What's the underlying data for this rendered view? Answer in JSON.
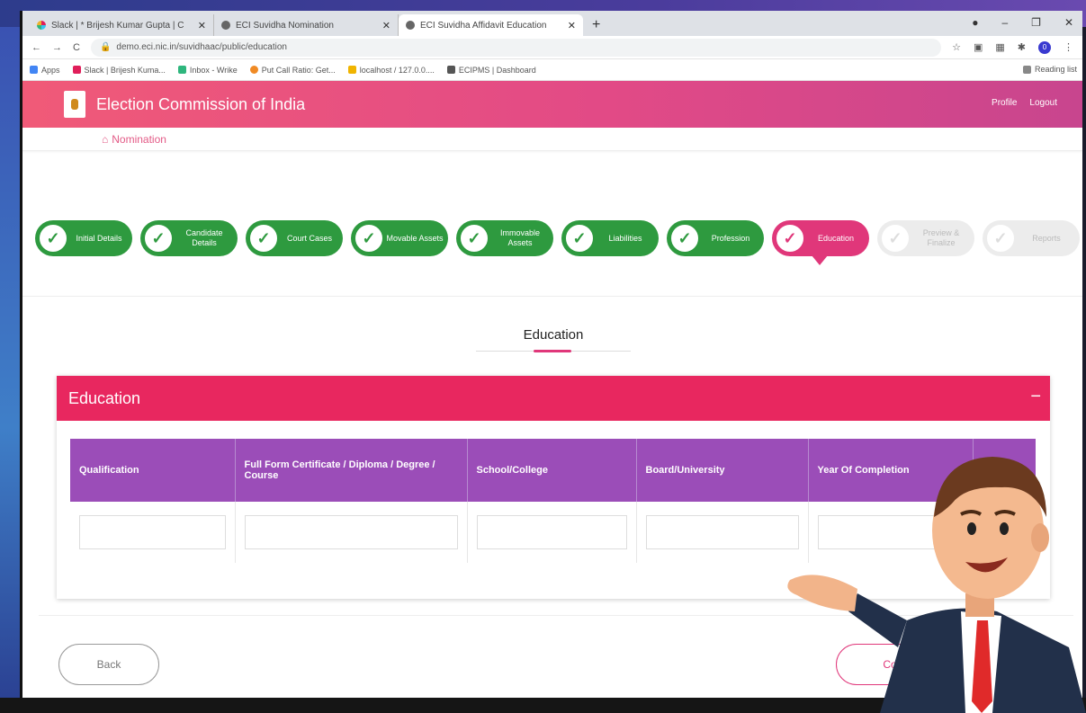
{
  "browser": {
    "tabs": [
      {
        "title": "Slack | * Brijesh Kumar Gupta | C",
        "icon": "slack-icon",
        "active": false
      },
      {
        "title": "ECI Suvidha Nomination",
        "icon": "globe-icon",
        "active": false
      },
      {
        "title": "ECI Suvidha Affidavit Education",
        "icon": "globe-icon",
        "active": true
      }
    ],
    "url": "demo.eci.nic.in/suvidhaac/public/education",
    "bookmarks": [
      "Apps",
      "Slack | Brijesh Kuma...",
      "Inbox - Wrike",
      "Put Call Ratio: Get...",
      "localhost / 127.0.0....",
      "ECIPMS | Dashboard"
    ],
    "reading_list": "Reading list",
    "avatar_letter": "0"
  },
  "header": {
    "title": "Election Commission of India",
    "nav": [
      "Profile",
      "Logout"
    ]
  },
  "breadcrumb": "Nomination",
  "steps": [
    {
      "label": "Initial Details",
      "state": "done"
    },
    {
      "label": "Candidate Details",
      "state": "done"
    },
    {
      "label": "Court Cases",
      "state": "done"
    },
    {
      "label": "Movable Assets",
      "state": "done"
    },
    {
      "label": "Immovable Assets",
      "state": "done"
    },
    {
      "label": "Liabilities",
      "state": "done"
    },
    {
      "label": "Profession",
      "state": "done"
    },
    {
      "label": "Education",
      "state": "active"
    },
    {
      "label": "Preview & Finalize",
      "state": "todo"
    },
    {
      "label": "Reports",
      "state": "todo"
    }
  ],
  "section": {
    "title": "Education"
  },
  "card": {
    "title": "Education",
    "collapse_symbol": "−",
    "columns": [
      "Qualification",
      "Full Form Certificate / Diploma / Degree / Course",
      "School/College",
      "Board/University",
      "Year Of Completion",
      ""
    ]
  },
  "buttons": {
    "back": "Back",
    "continue": "Co"
  },
  "colors": {
    "primary": "#e8275f",
    "done": "#2e9a3f",
    "table_header": "#9b4db8"
  }
}
